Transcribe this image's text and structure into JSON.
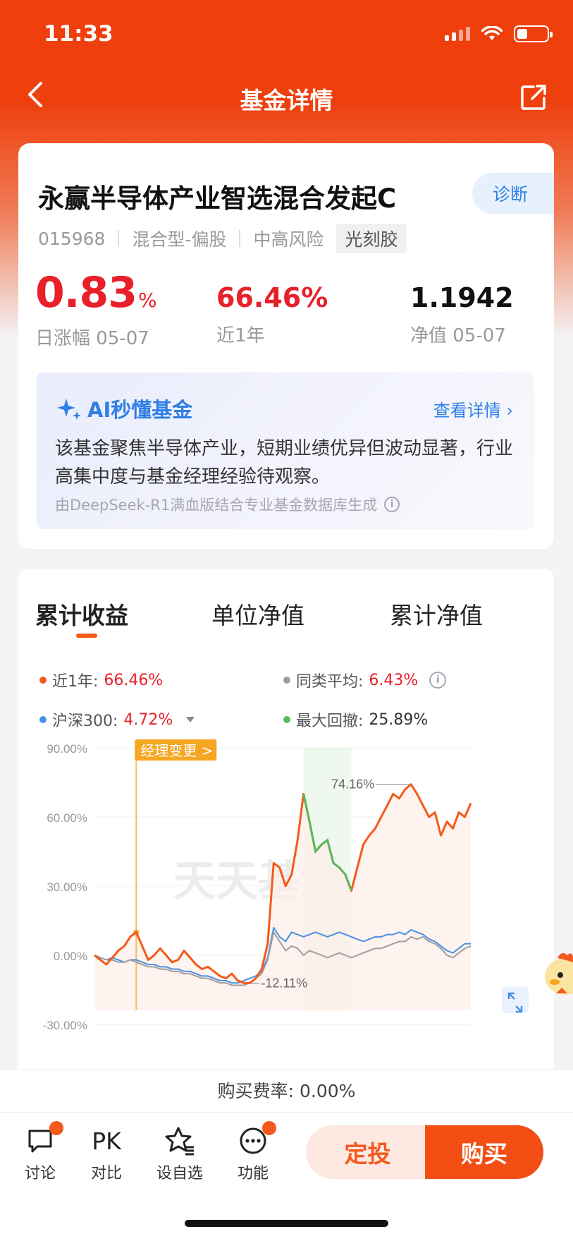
{
  "status": {
    "time": "11:33"
  },
  "nav": {
    "title": "基金详情"
  },
  "fund": {
    "name": "永赢半导体产业智选混合发起C",
    "code": "015968",
    "type": "混合型-偏股",
    "risk": "中高风险",
    "tag": "光刻胶",
    "diagnose": "诊断"
  },
  "kpi": {
    "daily_value": "0.83",
    "daily_unit": "%",
    "daily_label": "日涨幅 05-07",
    "year_value": "66.46%",
    "year_label": "近1年",
    "nav_value": "1.1942",
    "nav_label": "净值 05-07"
  },
  "ai": {
    "title": "AI秒懂基金",
    "link": "查看详情 ›",
    "text": "该基金聚焦半导体产业，短期业绩优异但波动显著，行业高集中度与基金经理经验待观察。",
    "source": "由DeepSeek-R1满血版结合专业基金数据库生成"
  },
  "tabs": [
    "累计收益",
    "单位净值",
    "累计净值"
  ],
  "legend": {
    "fund_label": "近1年:",
    "fund_value": "66.46%",
    "peer_label": "同类平均:",
    "peer_value": "6.43%",
    "hs300_label": "沪深300:",
    "hs300_value": "4.72%",
    "mdd_label": "最大回撤:",
    "mdd_value": "25.89%"
  },
  "colors": {
    "brand": "#ee3f0d",
    "fund_line": "#f35a1c",
    "peer_line": "#9e9e9e",
    "hs300_line": "#4a90e2",
    "drawdown": "#5cb85c",
    "up_red": "#e8202a"
  },
  "chart_data": {
    "type": "line",
    "y_ticks": [
      "90.00%",
      "60.00%",
      "30.00%",
      "0.00%",
      "-30.00%"
    ],
    "ylim": [
      -30,
      90
    ],
    "annotations": {
      "manager_change": "经理变更 >",
      "max_label": "74.16%",
      "min_label": "-12.11%",
      "watermark": "天天基金"
    },
    "series": [
      {
        "name": "近1年",
        "values": [
          0,
          -2,
          -4,
          -1,
          2,
          4,
          8,
          10,
          4,
          -2,
          0,
          3,
          0,
          -3,
          -2,
          2,
          -1,
          -4,
          -6,
          -5,
          -7,
          -9,
          -10,
          -8,
          -11,
          -12,
          -12.11,
          -10,
          -6,
          5,
          40,
          38,
          30,
          35,
          50,
          70,
          58,
          45,
          48,
          50,
          40,
          38,
          35,
          28,
          38,
          48,
          52,
          55,
          60,
          65,
          70,
          68,
          72,
          74.16,
          70,
          65,
          60,
          62,
          52,
          58,
          55,
          62,
          60,
          66
        ]
      },
      {
        "name": "同类平均",
        "values": [
          0,
          -1,
          -2,
          -2,
          -3,
          -3,
          -2,
          -3,
          -4,
          -5,
          -5,
          -6,
          -6,
          -7,
          -7,
          -8,
          -8,
          -9,
          -10,
          -10,
          -11,
          -12,
          -12,
          -13,
          -13,
          -13,
          -12,
          -10,
          -8,
          -2,
          10,
          6,
          2,
          4,
          3,
          0,
          2,
          1,
          0,
          -1,
          0,
          1,
          0,
          -1,
          0,
          1,
          2,
          3,
          3,
          4,
          5,
          6,
          6,
          8,
          7,
          8,
          6,
          5,
          3,
          0,
          -1,
          1,
          3,
          4
        ]
      },
      {
        "name": "沪深300",
        "values": [
          0,
          -1,
          -2,
          -1,
          -2,
          -3,
          -2,
          -2,
          -3,
          -4,
          -4,
          -5,
          -5,
          -6,
          -6,
          -7,
          -7,
          -8,
          -9,
          -9,
          -10,
          -11,
          -11,
          -12,
          -12,
          -11,
          -10,
          -9,
          -7,
          -1,
          12,
          8,
          6,
          10,
          9,
          8,
          9,
          10,
          9,
          8,
          9,
          10,
          9,
          8,
          7,
          6,
          7,
          8,
          8,
          9,
          9,
          10,
          9,
          11,
          10,
          9,
          7,
          6,
          4,
          2,
          1,
          3,
          5,
          5
        ]
      }
    ],
    "max_drawdown_pct": "25.89%"
  },
  "fee": "购买费率: 0.00%",
  "bottom": {
    "discuss": "讨论",
    "compare": "对比",
    "compare_icon": "PK",
    "watchlist": "设自选",
    "more": "功能",
    "dingtou": "定投",
    "buy": "购买"
  }
}
